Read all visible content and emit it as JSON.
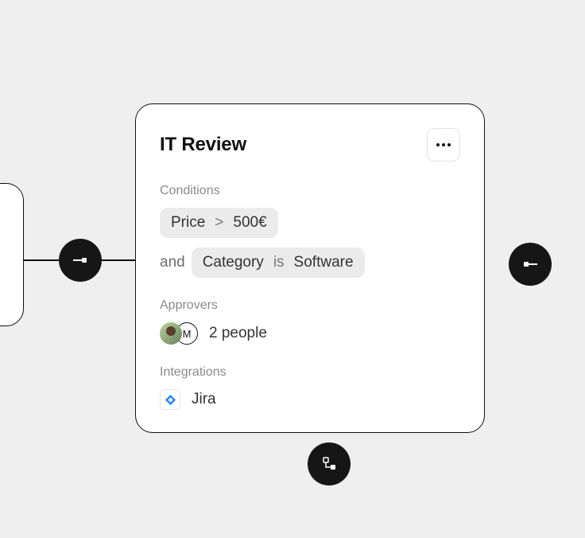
{
  "card": {
    "title": "IT Review",
    "conditions_label": "Conditions",
    "cond1": {
      "key": "Price",
      "op": ">",
      "value": "500€"
    },
    "joiner": "and",
    "cond2": {
      "key": "Category",
      "op": "is",
      "value": "Software"
    },
    "approvers_label": "Approvers",
    "approvers": {
      "letter": "M",
      "count_text": "2 people"
    },
    "integrations_label": "Integrations",
    "integration": {
      "name": "Jira"
    }
  }
}
